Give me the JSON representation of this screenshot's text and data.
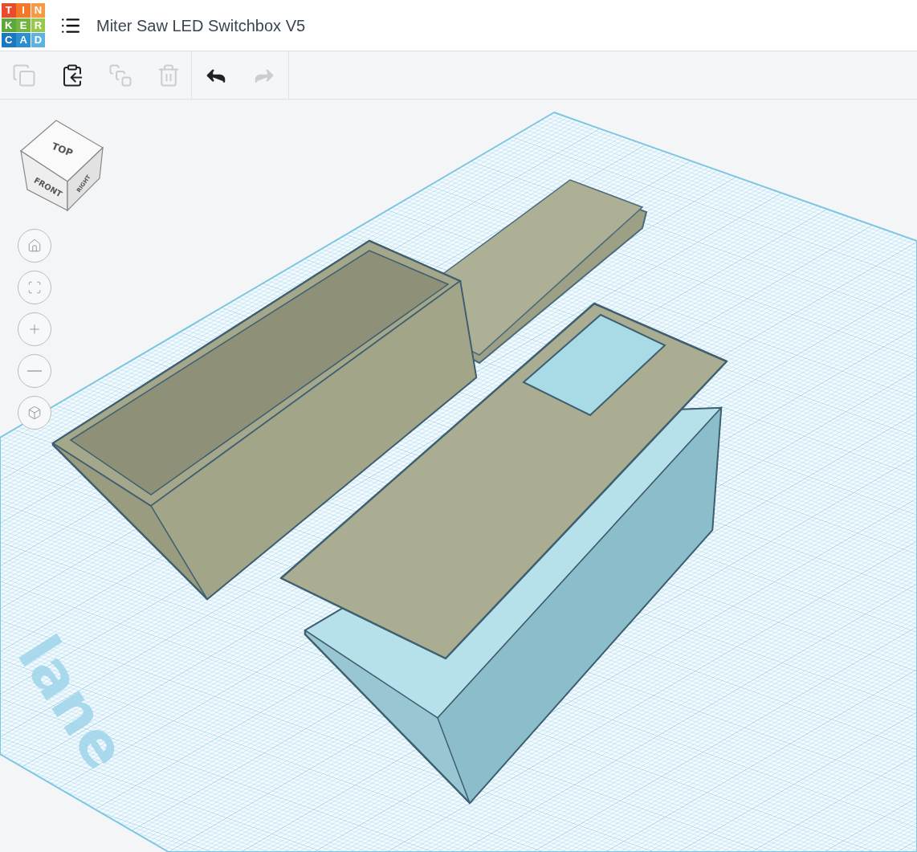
{
  "header": {
    "logo": [
      {
        "letter": "T",
        "color": "#e94b2d"
      },
      {
        "letter": "I",
        "color": "#f3792a"
      },
      {
        "letter": "N",
        "color": "#f79a45"
      },
      {
        "letter": "K",
        "color": "#5ea73c"
      },
      {
        "letter": "E",
        "color": "#74b53f"
      },
      {
        "letter": "R",
        "color": "#98c84c"
      },
      {
        "letter": "C",
        "color": "#1a78c0"
      },
      {
        "letter": "A",
        "color": "#2c90d0"
      },
      {
        "letter": "D",
        "color": "#5db3df"
      }
    ],
    "title": "Miter Saw LED Switchbox V5"
  },
  "toolbar": [
    {
      "kind": "copy",
      "disabled": true
    },
    {
      "kind": "paste",
      "disabled": false
    },
    {
      "kind": "duplicate",
      "disabled": true
    },
    {
      "kind": "delete",
      "disabled": true
    },
    {
      "kind": "undo",
      "disabled": false
    },
    {
      "kind": "redo",
      "disabled": true
    }
  ],
  "view_cube": {
    "faces": [
      "TOP",
      "FRONT",
      "RIGHT"
    ]
  },
  "workplane": {
    "label": "lane"
  }
}
